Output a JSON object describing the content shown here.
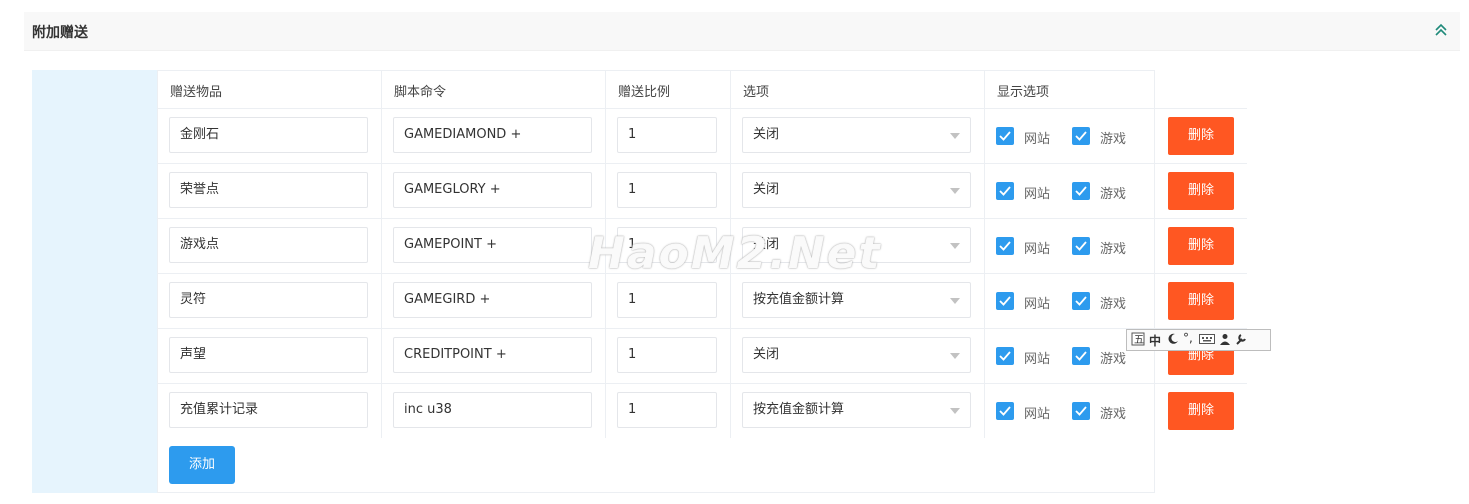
{
  "section": {
    "title": "附加赠送"
  },
  "columns": [
    "赠送物品",
    "脚本命令",
    "赠送比例",
    "选项",
    "显示选项"
  ],
  "rows": [
    {
      "item": "金刚石",
      "script": "GAMEDIAMOND +",
      "ratio": "1",
      "option": "关闭",
      "show_web": "网站",
      "show_game": "游戏",
      "delete_label": "删除"
    },
    {
      "item": "荣誉点",
      "script": "GAMEGLORY +",
      "ratio": "1",
      "option": "关闭",
      "show_web": "网站",
      "show_game": "游戏",
      "delete_label": "删除"
    },
    {
      "item": "游戏点",
      "script": "GAMEPOINT +",
      "ratio": "1",
      "option": "关闭",
      "show_web": "网站",
      "show_game": "游戏",
      "delete_label": "删除"
    },
    {
      "item": "灵符",
      "script": "GAMEGIRD +",
      "ratio": "1",
      "option": "按充值金额计算",
      "show_web": "网站",
      "show_game": "游戏",
      "delete_label": "删除"
    },
    {
      "item": "声望",
      "script": "CREDITPOINT +",
      "ratio": "1",
      "option": "关闭",
      "show_web": "网站",
      "show_game": "游戏",
      "delete_label": "删除"
    },
    {
      "item": "充值累计记录",
      "script": "inc u38",
      "ratio": "1",
      "option": "按充值金额计算",
      "show_web": "网站",
      "show_game": "游戏",
      "delete_label": "删除"
    }
  ],
  "add_label": "添加",
  "watermark": "HaoM2.Net",
  "ime": {
    "mode": "中",
    "icons": [
      "ime-logo-icon",
      "moon-icon",
      "punctuation-icon",
      "keyboard-icon",
      "user-icon",
      "wrench-icon"
    ]
  },
  "colors": {
    "accent": "#2d9bee",
    "danger": "#ff5722",
    "strip": "#e6f4fd"
  }
}
